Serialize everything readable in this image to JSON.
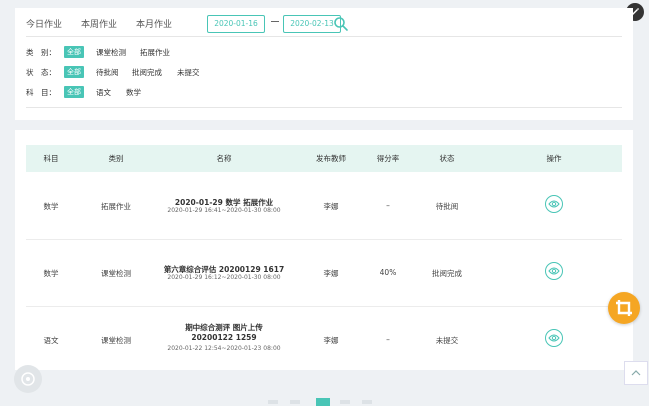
{
  "tabs": [
    "今日作业",
    "本周作业",
    "本月作业"
  ],
  "date_range": {
    "start": "2020-01-16",
    "end": "2020-02-13"
  },
  "filters": {
    "category": {
      "label": "类　别：",
      "options": [
        "全部",
        "课堂检测",
        "拓展作业"
      ],
      "selected": "全部"
    },
    "status": {
      "label": "状　态：",
      "options": [
        "全部",
        "待批阅",
        "批阅完成",
        "未提交"
      ],
      "selected": "全部"
    },
    "subject": {
      "label": "科　目：",
      "options": [
        "全部",
        "语文",
        "数学"
      ],
      "selected": "全部"
    }
  },
  "table": {
    "headers": [
      "科目",
      "类别",
      "名称",
      "发布教师",
      "得分率",
      "状态",
      "操作"
    ],
    "rows": [
      {
        "subject": "数学",
        "category": "拓展作业",
        "name": "2020-01-29 数学 拓展作业",
        "time": "2020-01-29 16:41~2020-01-30 08:00",
        "teacher": "李娜",
        "score": "–",
        "status": "待批阅"
      },
      {
        "subject": "数学",
        "category": "课堂检测",
        "name": "第六章综合评估 20200129 1617",
        "time": "2020-01-29 16:12~2020-01-30 08:00",
        "teacher": "李娜",
        "score": "40%",
        "status": "批阅完成"
      },
      {
        "subject": "语文",
        "category": "课堂检测",
        "name": "期中综合测评 图片上传 20200122 1259",
        "time": "2020-01-22 12:54~2020-01-23 08:00",
        "teacher": "李娜",
        "score": "–",
        "status": "未提交"
      }
    ]
  },
  "pagination": {
    "current": "1"
  },
  "colors": {
    "accent": "#49c5b6",
    "fab": "#f5a623",
    "header_bg": "#e5f5f1"
  },
  "icons": [
    "search-icon",
    "eye-icon",
    "crop-icon",
    "chevron-up-icon",
    "edit-icon"
  ]
}
